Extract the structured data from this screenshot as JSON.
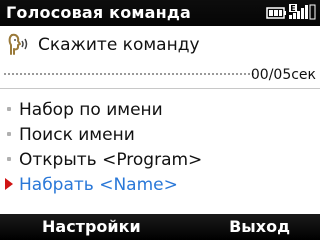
{
  "titlebar": {
    "title": "Голосовая команда",
    "icons": [
      "battery-icon",
      "data-connection-icon",
      "signal-icon"
    ]
  },
  "header": {
    "icon": "voice-command-icon",
    "prompt": "Скажите команду"
  },
  "progress": {
    "timer": "00/05сек",
    "value": 0
  },
  "commands": [
    {
      "label": "Набор по имени",
      "selected": false
    },
    {
      "label": "Поиск имени",
      "selected": false
    },
    {
      "label": "Открыть <Program>",
      "selected": false
    },
    {
      "label": "Набрать <Name>",
      "selected": true
    }
  ],
  "softkeys": {
    "left": "Настройки",
    "right": "Выход"
  },
  "colors": {
    "bar_background": "#000000",
    "selected_text": "#2a78d8",
    "selection_arrow": "#d01414"
  }
}
